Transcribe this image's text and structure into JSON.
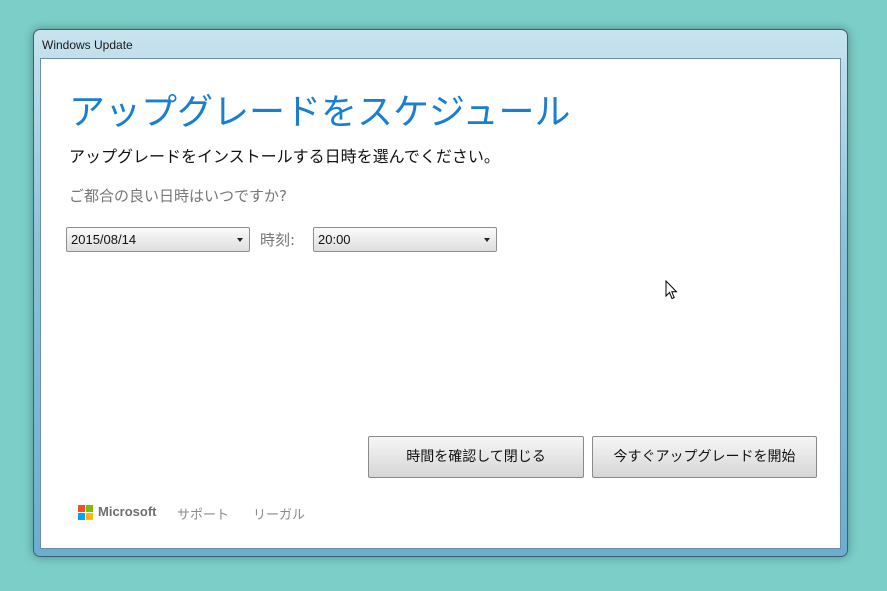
{
  "window": {
    "title": "Windows Update"
  },
  "dialog": {
    "heading": "アップグレードをスケジュール",
    "subtitle": "アップグレードをインストールする日時を選んでください。",
    "question": "ご都合の良い日時はいつですか?",
    "date_select": {
      "value": "2015/08/14"
    },
    "time_label": "時刻:",
    "time_select": {
      "value": "20:00"
    },
    "buttons": {
      "confirm_close": "時間を確認して閉じる",
      "upgrade_now": "今すぐアップグレードを開始"
    }
  },
  "footer": {
    "brand": "Microsoft",
    "support": "サポート",
    "legal": "リーガル"
  },
  "colors": {
    "accent": "#1a7fd0",
    "logo_red": "#f25022",
    "logo_green": "#7fba00",
    "logo_blue": "#00a4ef",
    "logo_yellow": "#ffb900"
  },
  "icons": {
    "select_arrow": "chevron-down-icon",
    "cursor": "mouse-pointer-icon",
    "logo": "microsoft-logo-icon"
  }
}
